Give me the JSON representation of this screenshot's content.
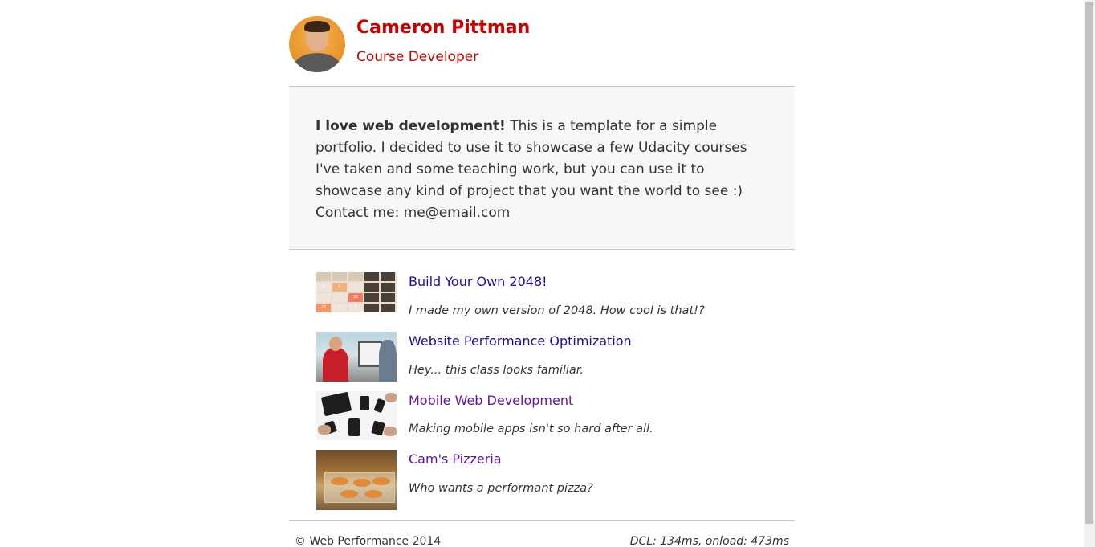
{
  "profile": {
    "name": "Cameron Pittman",
    "role": "Course Developer"
  },
  "about": {
    "lead": "I love web development!",
    "text": " This is a template for a simple portfolio. I decided to use it to showcase a few Udacity courses I've taken and some teaching work, but you can use it to showcase any kind of project that you want the world to see :)",
    "contact": "Contact me: me@email.com"
  },
  "projects": [
    {
      "title": "Build Your Own 2048!",
      "description": "I made my own version of 2048. How cool is that!?",
      "visited": false
    },
    {
      "title": "Website Performance Optimization",
      "description": "Hey... this class looks familiar.",
      "visited": false
    },
    {
      "title": "Mobile Web Development",
      "description": "Making mobile apps isn't so hard after all.",
      "visited": true
    },
    {
      "title": "Cam's Pizzeria",
      "description": "Who wants a performant pizza?",
      "visited": true
    }
  ],
  "footer": {
    "copyright": "© Web Performance 2014",
    "perf": "DCL: 134ms, onload: 473ms"
  },
  "tiles_2048": [
    "4",
    "8",
    "",
    "",
    "",
    "32",
    "16",
    "4",
    "2",
    "",
    "256",
    "128",
    "64",
    "32",
    ""
  ],
  "colors": {
    "accent": "#cc0000",
    "link": "#1a0dab",
    "visited_link": "#6611aa",
    "about_bg": "#f7f7f7"
  }
}
